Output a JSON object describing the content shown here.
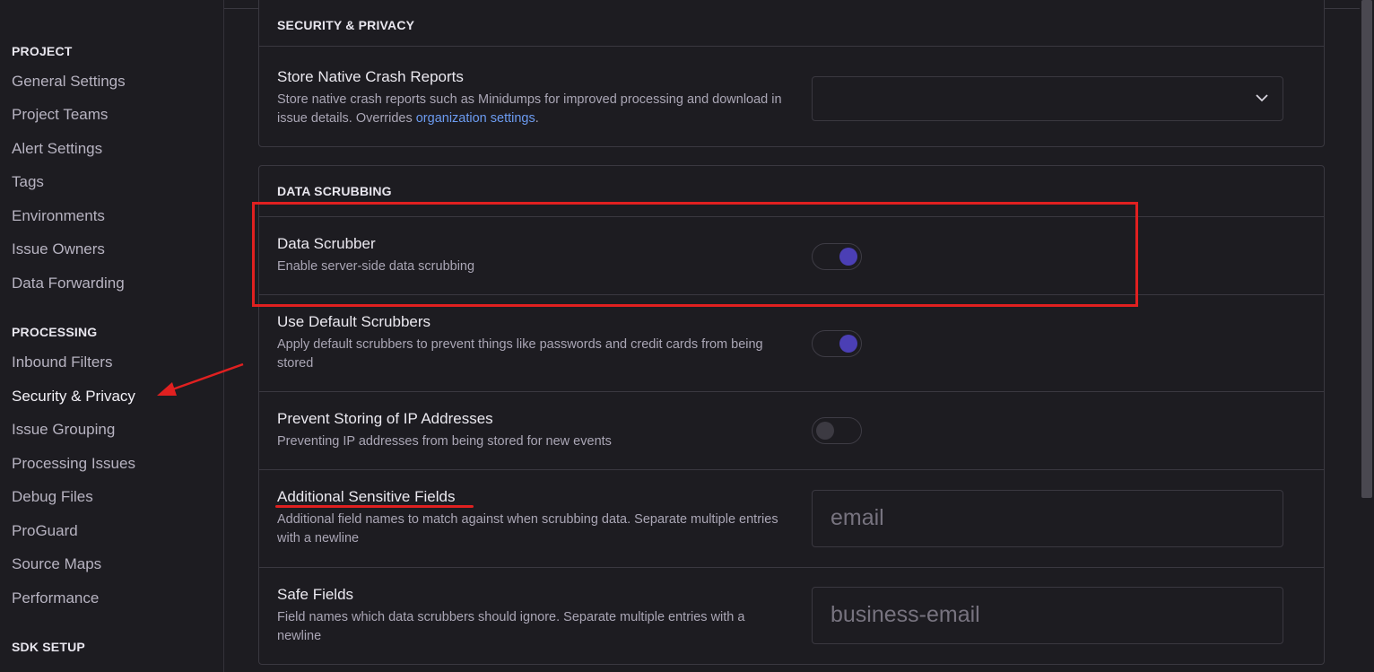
{
  "sidebar": {
    "sections": [
      {
        "heading": "PROJECT",
        "items": [
          "General Settings",
          "Project Teams",
          "Alert Settings",
          "Tags",
          "Environments",
          "Issue Owners",
          "Data Forwarding"
        ]
      },
      {
        "heading": "PROCESSING",
        "items": [
          "Inbound Filters",
          "Security & Privacy",
          "Issue Grouping",
          "Processing Issues",
          "Debug Files",
          "ProGuard",
          "Source Maps",
          "Performance"
        ]
      },
      {
        "heading": "SDK SETUP"
      }
    ],
    "active_item": "Security & Privacy"
  },
  "security_panel": {
    "title": "SECURITY & PRIVACY",
    "crash_reports": {
      "label": "Store Native Crash Reports",
      "help_text": "Store native crash reports such as Minidumps for improved processing and download in issue details. Overrides",
      "help_link": "organization settings",
      "help_suffix": ".",
      "select_value": ""
    }
  },
  "scrubbing_panel": {
    "title": "DATA SCRUBBING",
    "data_scrubber": {
      "label": "Data Scrubber",
      "help": "Enable server-side data scrubbing",
      "enabled": true
    },
    "default_scrubbers": {
      "label": "Use Default Scrubbers",
      "help": "Apply default scrubbers to prevent things like passwords and credit cards from being stored",
      "enabled": true
    },
    "prevent_ip": {
      "label": "Prevent Storing of IP Addresses",
      "help": "Preventing IP addresses from being stored for new events",
      "enabled": false
    },
    "sensitive_fields": {
      "label": "Additional Sensitive Fields",
      "help": "Additional field names to match against when scrubbing data. Separate multiple entries with a newline",
      "value": "email"
    },
    "safe_fields": {
      "label": "Safe Fields",
      "help": "Field names which data scrubbers should ignore. Separate multiple entries with a newline",
      "value": "business-email"
    }
  },
  "colors": {
    "background": "#1d1c21",
    "accent_toggle": "#4b3fb5",
    "link": "#6c9bf0",
    "annotation": "#e02020"
  }
}
